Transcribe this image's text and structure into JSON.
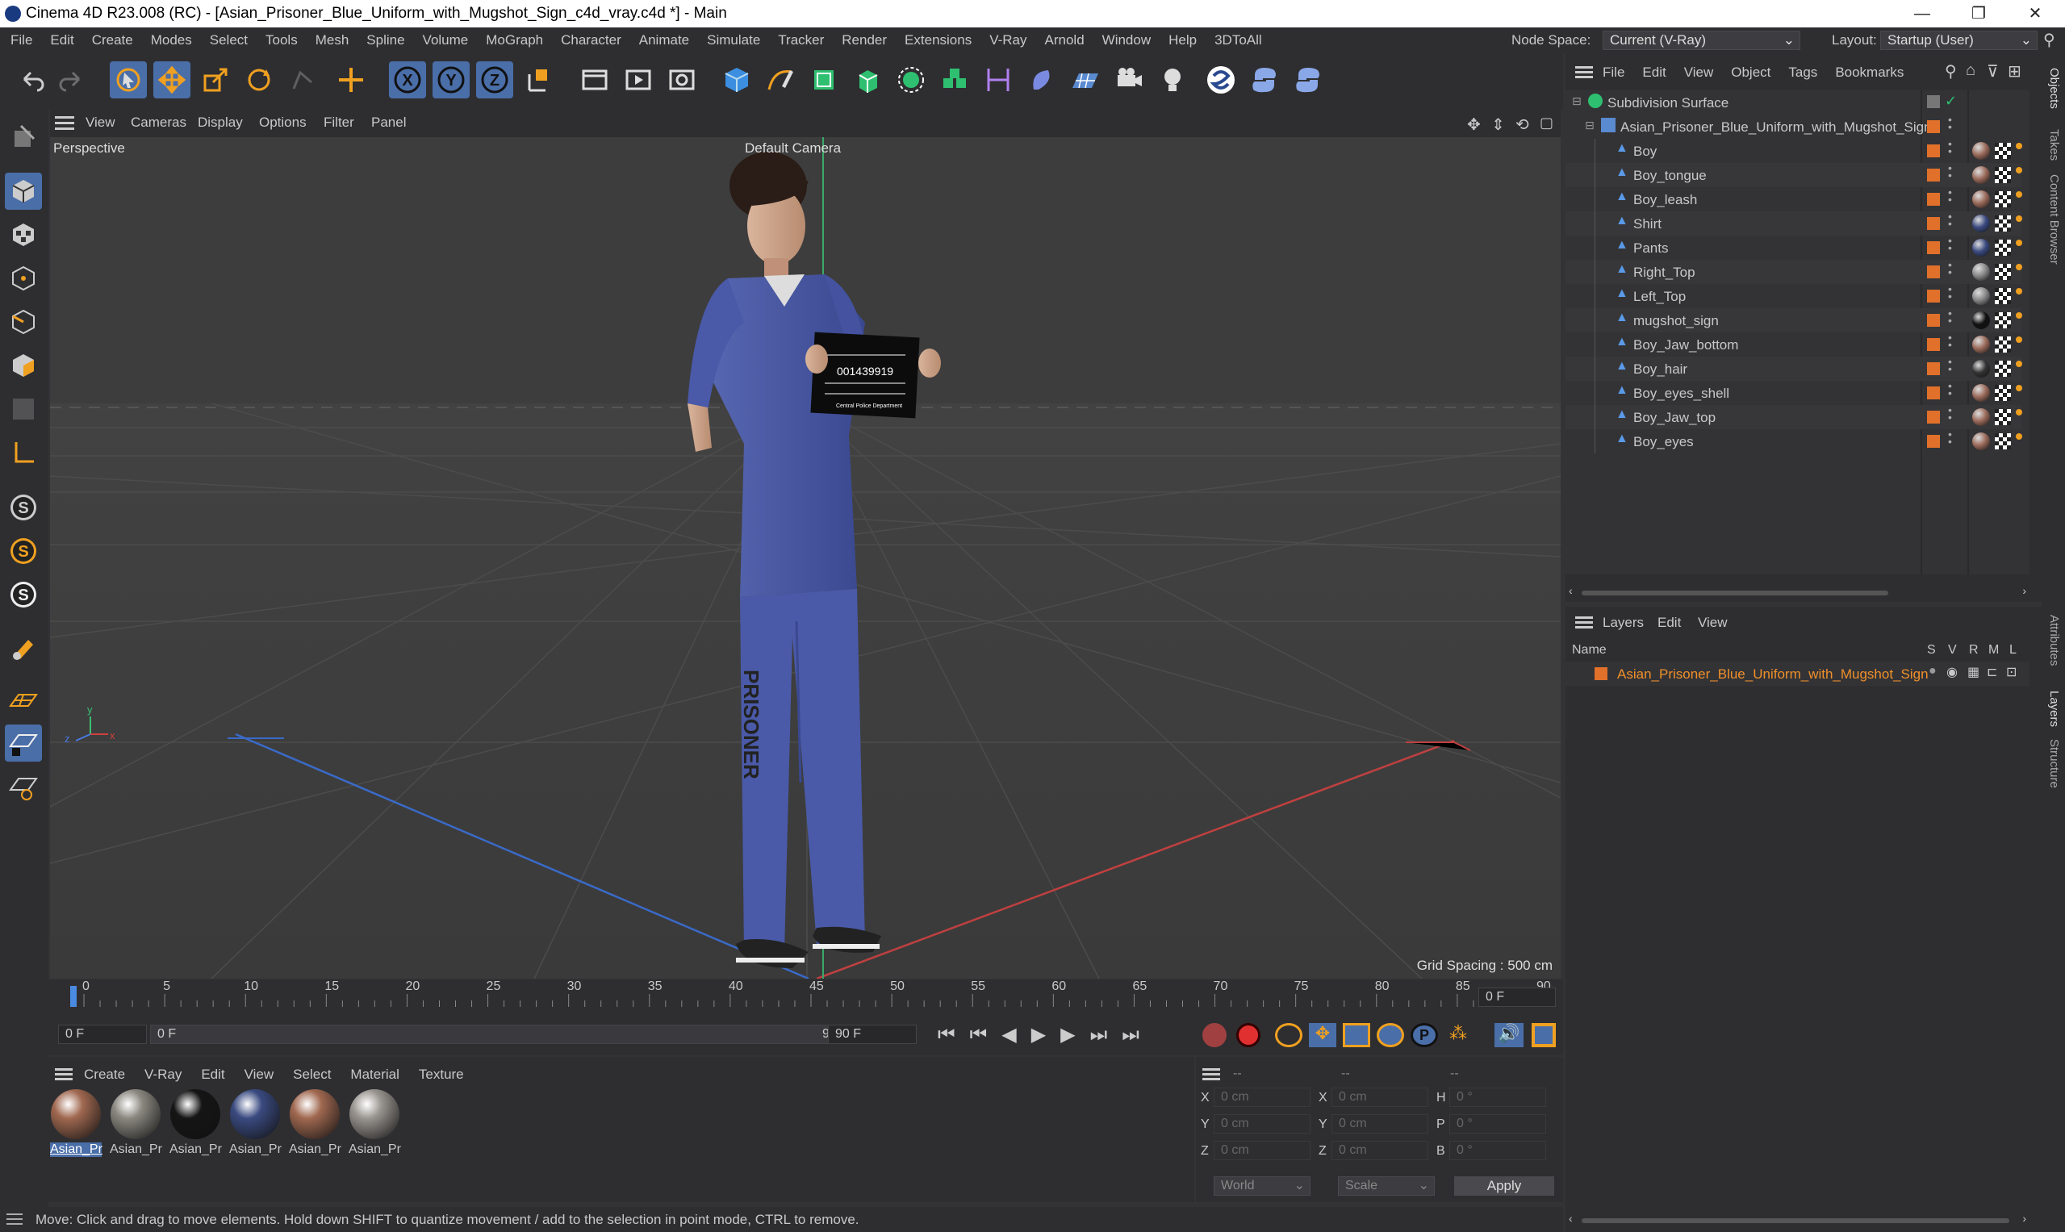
{
  "title": "Cinema 4D R23.008 (RC) - [Asian_Prisoner_Blue_Uniform_with_Mugshot_Sign_c4d_vray.c4d *] - Main",
  "menu": [
    "File",
    "Edit",
    "Create",
    "Modes",
    "Select",
    "Tools",
    "Mesh",
    "Spline",
    "Volume",
    "MoGraph",
    "Character",
    "Animate",
    "Simulate",
    "Tracker",
    "Render",
    "Extensions",
    "V-Ray",
    "Arnold",
    "Window",
    "Help",
    "3DToAll"
  ],
  "node_space_label": "Node Space:",
  "node_space_value": "Current (V-Ray)",
  "layout_label": "Layout:",
  "layout_value": "Startup (User)",
  "viewport": {
    "menu": [
      "View",
      "Cameras",
      "Display",
      "Options",
      "Filter",
      "Panel"
    ],
    "label": "Perspective",
    "camera": "Default Camera",
    "grid": "Grid Spacing : 500 cm",
    "sign_number": "001439919",
    "sign_footer": "Central Police Department",
    "pants_text": "PRISONER"
  },
  "timeline": {
    "ticks": [
      "0",
      "5",
      "10",
      "15",
      "20",
      "25",
      "30",
      "35",
      "40",
      "45",
      "50",
      "55",
      "60",
      "65",
      "70",
      "75",
      "80",
      "85",
      "90"
    ],
    "current": "0 F"
  },
  "transport": {
    "start": "0 F",
    "range_start": "0 F",
    "range_end": "90 F",
    "end": "90 F"
  },
  "materials": {
    "menu": [
      "Create",
      "V-Ray",
      "Edit",
      "View",
      "Select",
      "Material",
      "Texture"
    ],
    "items": [
      "Asian_Pr",
      "Asian_Pr",
      "Asian_Pr",
      "Asian_Pr",
      "Asian_Pr",
      "Asian_Pr"
    ],
    "colors": [
      "#a06850",
      "#8a8880",
      "#151515",
      "#3a4a80",
      "#a06850",
      "#9a9590"
    ]
  },
  "attributes": {
    "header1": "--",
    "header2": "--",
    "header3": "--",
    "rows": [
      [
        "X",
        "0 cm",
        "X",
        "0 cm",
        "H",
        "0 °"
      ],
      [
        "Y",
        "0 cm",
        "Y",
        "0 cm",
        "P",
        "0 °"
      ],
      [
        "Z",
        "0 cm",
        "Z",
        "0 cm",
        "B",
        "0 °"
      ]
    ],
    "coord": "World",
    "mode": "Scale",
    "apply": "Apply"
  },
  "objects": {
    "menu": [
      "File",
      "Edit",
      "View",
      "Object",
      "Tags",
      "Bookmarks"
    ],
    "root": "Subdivision Surface",
    "group": "Asian_Prisoner_Blue_Uniform_with_Mugshot_Sign",
    "items": [
      "Boy",
      "Boy_tongue",
      "Boy_leash",
      "Shirt",
      "Pants",
      "Right_Top",
      "Left_Top",
      "mugshot_sign",
      "Boy_Jaw_bottom",
      "Boy_hair",
      "Boy_eyes_shell",
      "Boy_Jaw_top",
      "Boy_eyes"
    ],
    "tagcolors": [
      "#9a6a5a",
      "#9a6a5a",
      "#9a6a5a",
      "#3a4a80",
      "#3a4a80",
      "#888",
      "#888",
      "#111",
      "#9a6a5a",
      "#333",
      "#9a6a5a",
      "#9a6a5a",
      "#9a6a5a"
    ]
  },
  "layers": {
    "menu": [
      "Layers",
      "Edit",
      "View"
    ],
    "cols": {
      "name": "Name",
      "s": "S",
      "v": "V",
      "r": "R",
      "m": "M",
      "l": "L"
    },
    "item": "Asian_Prisoner_Blue_Uniform_with_Mugshot_Sign"
  },
  "sidetabs": [
    "Objects",
    "Takes",
    "Content Browser",
    "Attributes",
    "Layers",
    "Structure"
  ],
  "status": "Move: Click and drag to move elements. Hold down SHIFT to quantize movement / add to the selection in point mode, CTRL to remove."
}
